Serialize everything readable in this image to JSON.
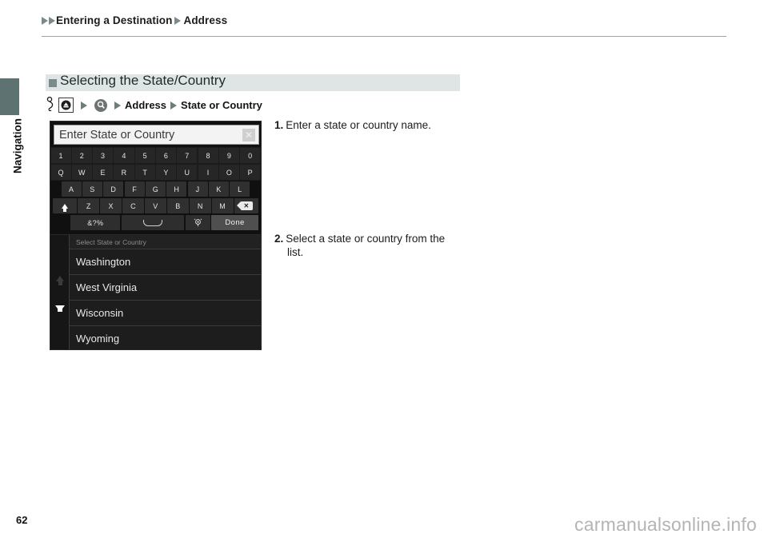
{
  "breadcrumb": {
    "item1": "Entering a Destination",
    "item2": "Address"
  },
  "sidebar": {
    "tab_label": "Navigation"
  },
  "section": {
    "title": "Selecting the State/Country"
  },
  "nav_path": {
    "icons": [
      "hand-press-icon",
      "home-button-icon",
      "search-magnifier-icon"
    ],
    "item1": "Address",
    "item2": "State or Country"
  },
  "keyboard_screen": {
    "input_placeholder": "Enter State or Country",
    "clear_label": "✕",
    "row_numbers": [
      "1",
      "2",
      "3",
      "4",
      "5",
      "6",
      "7",
      "8",
      "9",
      "0"
    ],
    "row_top": [
      "Q",
      "W",
      "E",
      "R",
      "T",
      "Y",
      "U",
      "I",
      "O",
      "P"
    ],
    "row_home": [
      "A",
      "S",
      "D",
      "F",
      "G",
      "H",
      "J",
      "K",
      "L"
    ],
    "row_bottom": [
      "Z",
      "X",
      "C",
      "V",
      "B",
      "N",
      "M"
    ],
    "shift_label": "shift-key",
    "backspace_label": "backspace-key",
    "symbols_label": "&?%",
    "space_label": "space-bar",
    "voice_label": "voice-input-icon",
    "done_label": "Done"
  },
  "list_screen": {
    "header": "Select State or Country",
    "items": [
      "Washington",
      "West Virginia",
      "Wisconsin",
      "Wyoming"
    ],
    "scroll_up": "scroll-up-arrow",
    "scroll_down": "scroll-down-arrow"
  },
  "steps": [
    {
      "num": "1.",
      "text": "Enter a state or country name.",
      "cont": ""
    },
    {
      "num": "2.",
      "text": "Select a state or country from the",
      "cont": "list."
    }
  ],
  "footer": {
    "page_number": "62",
    "watermark": "carmanualsonline.info"
  },
  "colors": {
    "accent_band": "#dfe4e4",
    "tab": "#5f7272",
    "triangle": "#7b8a8a",
    "screen_bg": "#101010"
  }
}
